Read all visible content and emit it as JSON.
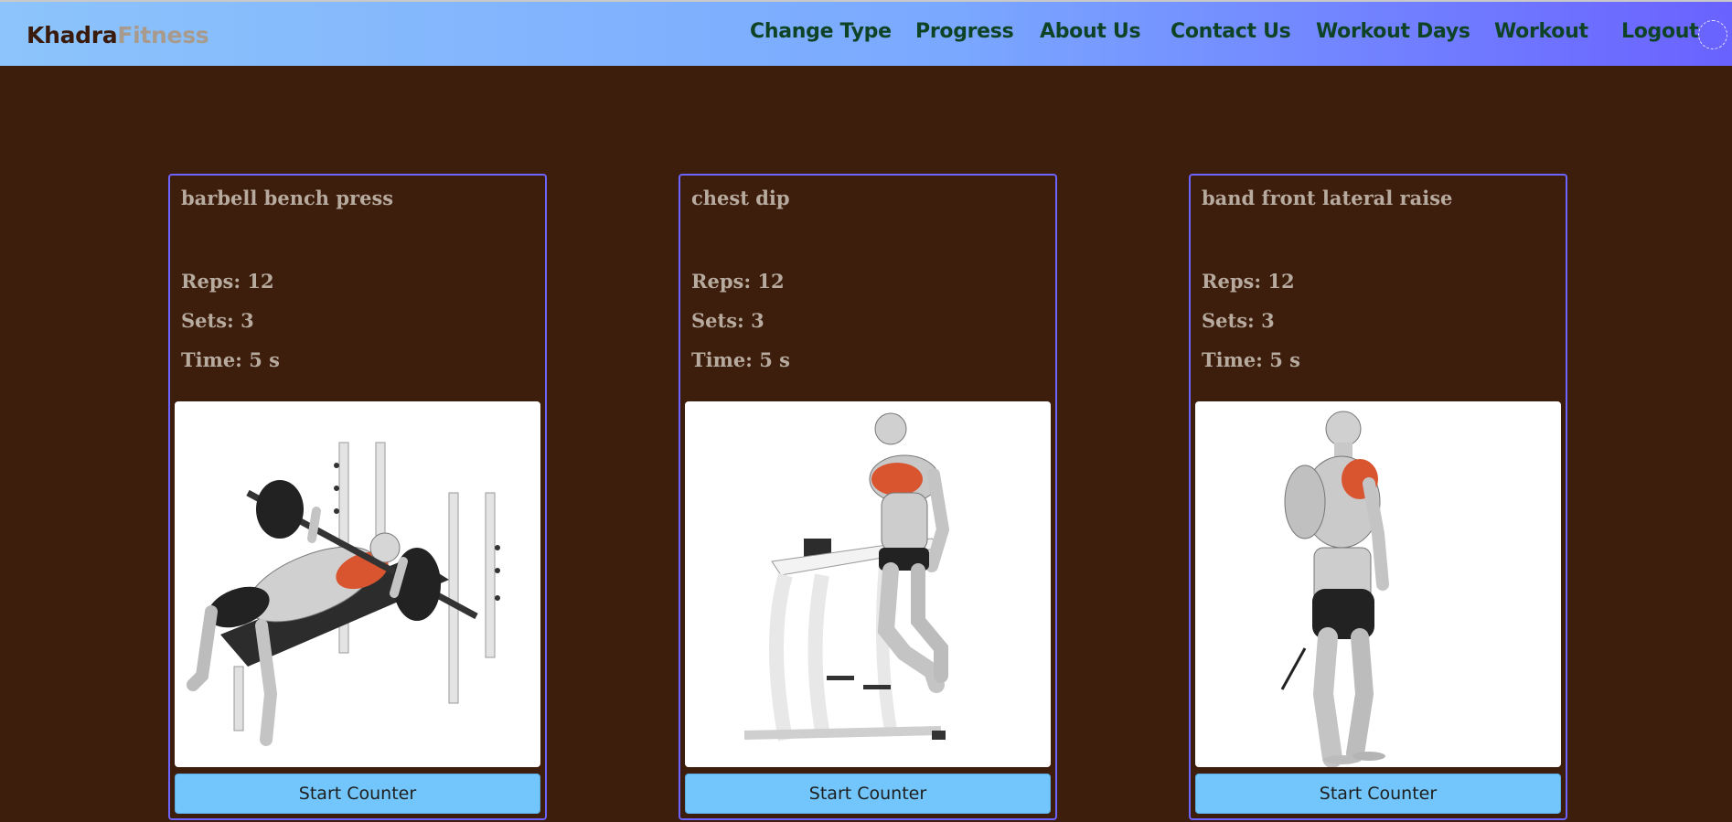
{
  "brand": {
    "part1": "Khadra",
    "part2": "Fitness"
  },
  "nav": {
    "change_type": "Change Type",
    "progress": "Progress",
    "about": "About Us",
    "contact": "Contact Us",
    "workout_days": "Workout Days",
    "workout": "Workout",
    "logout": "Logout"
  },
  "exercises": [
    {
      "name": "barbell bench press",
      "reps": "Reps: 12",
      "sets": "Sets: 3",
      "time": "Time: 5 s",
      "button": "Start Counter"
    },
    {
      "name": "chest dip",
      "reps": "Reps: 12",
      "sets": "Sets: 3",
      "time": "Time: 5 s",
      "button": "Start Counter"
    },
    {
      "name": "band front lateral raise",
      "reps": "Reps: 12",
      "sets": "Sets: 3",
      "time": "Time: 5 s",
      "button": "Start Counter"
    }
  ],
  "colors": {
    "background": "#3d1d0b",
    "card_border": "#6d63ff",
    "button": "#72c6fb",
    "nav_text": "#0f4326",
    "muscle_highlight": "#d9552f"
  }
}
